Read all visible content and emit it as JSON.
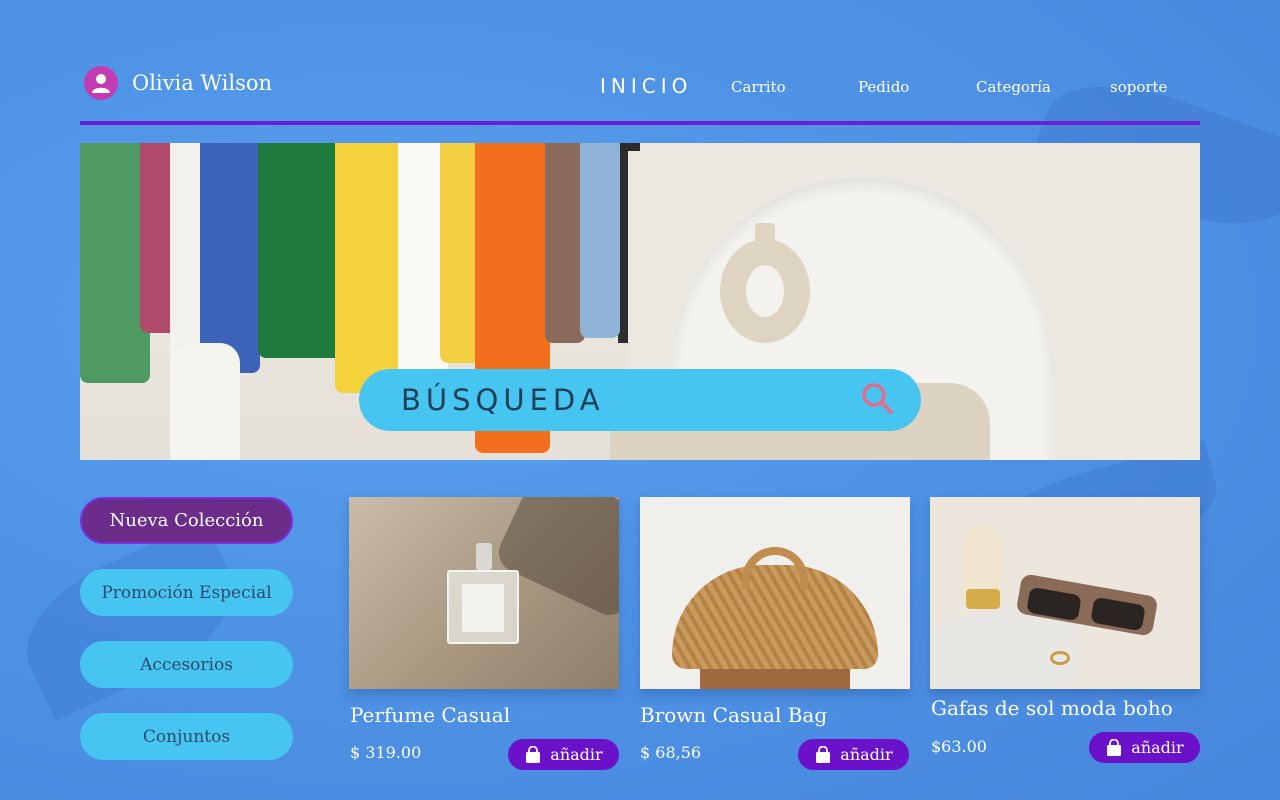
{
  "user": {
    "name": "Olivia Wilson",
    "avatar_icon": "user-icon"
  },
  "nav": {
    "home": "INICIO",
    "items": [
      "Carrito",
      "Pedido",
      "Categoría",
      "soporte"
    ]
  },
  "search": {
    "placeholder": "BÚSQUEDA",
    "icon": "search-icon"
  },
  "sidebar": {
    "items": [
      {
        "label": "Nueva Colección",
        "active": true
      },
      {
        "label": "Promoción Especial"
      },
      {
        "label": "Accesorios"
      },
      {
        "label": "Conjuntos"
      }
    ]
  },
  "products": [
    {
      "name": "Perfume Casual",
      "price": "$ 319.00",
      "button": "añadir",
      "image": "perfume bottle on sand"
    },
    {
      "name": "Brown Casual Bag",
      "price": "$ 68,56",
      "button": "añadir",
      "image": "woven straw bag"
    },
    {
      "name": "Gafas de sol moda boho",
      "price": "$63.00",
      "button": "añadir",
      "image": "sunglasses on marble"
    }
  ],
  "colors": {
    "background": "#4f93e6",
    "accent": "#6a11c9",
    "divider": "#6a1fd0",
    "search_bg": "#45c5ef",
    "active_tab": "#6b2c8a",
    "avatar": "#c23bb3"
  }
}
